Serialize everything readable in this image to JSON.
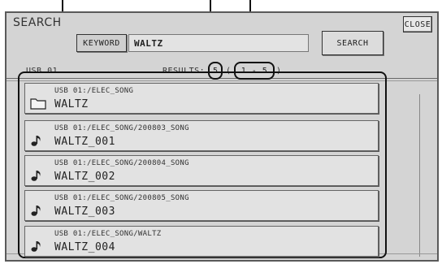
{
  "window": {
    "title": "SEARCH",
    "close_label": "CLOSE"
  },
  "search": {
    "keyword_label": "KEYWORD",
    "keyword_value": "WALTZ",
    "search_label": "SEARCH"
  },
  "location": "USB 01",
  "results": {
    "label": "RESULTS:",
    "count": "5",
    "open_paren": "(",
    "range": "1 - 5",
    "close_paren": ")"
  },
  "items": [
    {
      "icon": "folder-icon",
      "path": "USB 01:/ELEC_SONG",
      "name": "WALTZ"
    },
    {
      "icon": "music-note-icon",
      "path": "USB 01:/ELEC_SONG/200803_SONG",
      "name": "WALTZ_001"
    },
    {
      "icon": "music-note-icon",
      "path": "USB 01:/ELEC_SONG/200804_SONG",
      "name": "WALTZ_002"
    },
    {
      "icon": "music-note-icon",
      "path": "USB 01:/ELEC_SONG/200805_SONG",
      "name": "WALTZ_003"
    },
    {
      "icon": "music-note-icon",
      "path": "USB 01:/ELEC_SONG/WALTZ",
      "name": "WALTZ_004"
    }
  ]
}
